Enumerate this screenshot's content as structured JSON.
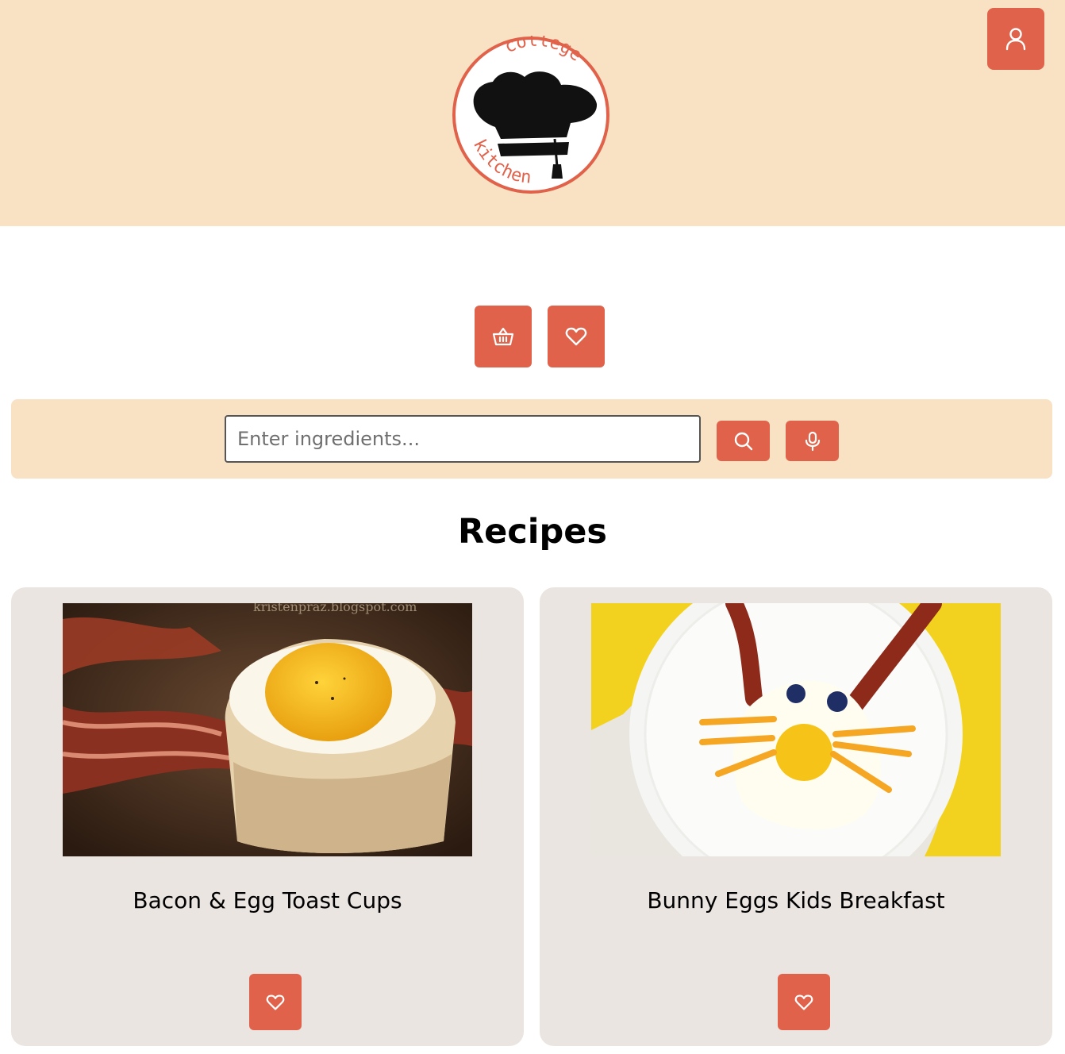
{
  "logo": {
    "top_text": "college",
    "bottom_text": "kitchen"
  },
  "header": {
    "profile_icon": "user-icon"
  },
  "actions": {
    "basket_icon": "basket-icon",
    "favorites_icon": "heart-icon"
  },
  "search": {
    "placeholder": "Enter ingredients...",
    "value": "",
    "search_icon": "search-icon",
    "mic_icon": "microphone-icon"
  },
  "recipes": {
    "title": "Recipes",
    "items": [
      {
        "name": "Bacon & Egg Toast Cups",
        "image_watermark": "kristenpraz.blogspot.com",
        "fav_icon": "heart-icon"
      },
      {
        "name": "Bunny Eggs Kids Breakfast",
        "fav_icon": "heart-icon"
      }
    ]
  },
  "colors": {
    "accent": "#e0624a",
    "header_bg": "#f9e2c3",
    "card_bg": "#ebe5e2"
  }
}
